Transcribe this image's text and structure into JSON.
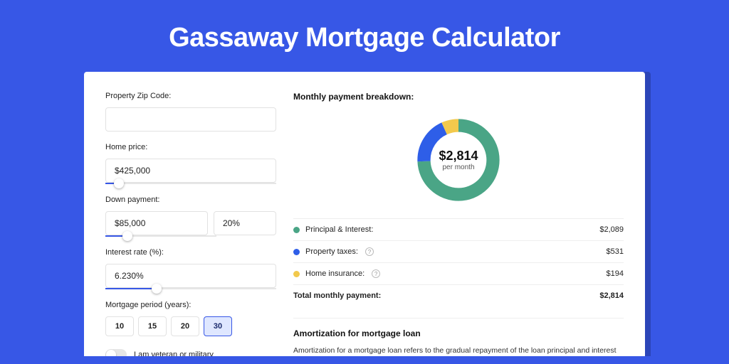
{
  "page": {
    "title": "Gassaway Mortgage Calculator"
  },
  "colors": {
    "principal": "#4aa586",
    "taxes": "#2e5ee8",
    "insurance": "#f2c94c",
    "brand": "#3757e6"
  },
  "form": {
    "zip": {
      "label": "Property Zip Code:",
      "value": ""
    },
    "homePrice": {
      "label": "Home price:",
      "value": "$425,000",
      "sliderPercent": 8
    },
    "downPayment": {
      "label": "Down payment:",
      "amount": "$85,000",
      "percent": "20%",
      "sliderPercent": 20
    },
    "interestRate": {
      "label": "Interest rate (%):",
      "value": "6.230%",
      "sliderPercent": 30
    },
    "period": {
      "label": "Mortgage period (years):",
      "options": [
        "10",
        "15",
        "20",
        "30"
      ],
      "selected": "30"
    },
    "veteran": {
      "label": "I am veteran or military",
      "checked": false
    }
  },
  "breakdown": {
    "title": "Monthly payment breakdown:",
    "centerAmount": "$2,814",
    "centerSub": "per month",
    "items": [
      {
        "key": "principal",
        "label": "Principal & Interest:",
        "value": "$2,089",
        "help": false
      },
      {
        "key": "taxes",
        "label": "Property taxes:",
        "value": "$531",
        "help": true
      },
      {
        "key": "insurance",
        "label": "Home insurance:",
        "value": "$194",
        "help": true
      }
    ],
    "totalLabel": "Total monthly payment:",
    "totalValue": "$2,814"
  },
  "chart_data": {
    "type": "pie",
    "title": "Monthly payment breakdown",
    "categories": [
      "Principal & Interest",
      "Property taxes",
      "Home insurance"
    ],
    "values": [
      2089,
      531,
      194
    ],
    "colors": [
      "#4aa586",
      "#2e5ee8",
      "#f2c94c"
    ],
    "total": 2814,
    "center_label": "$2,814 per month"
  },
  "amortization": {
    "title": "Amortization for mortgage loan",
    "text": "Amortization for a mortgage loan refers to the gradual repayment of the loan principal and interest over a specified"
  }
}
